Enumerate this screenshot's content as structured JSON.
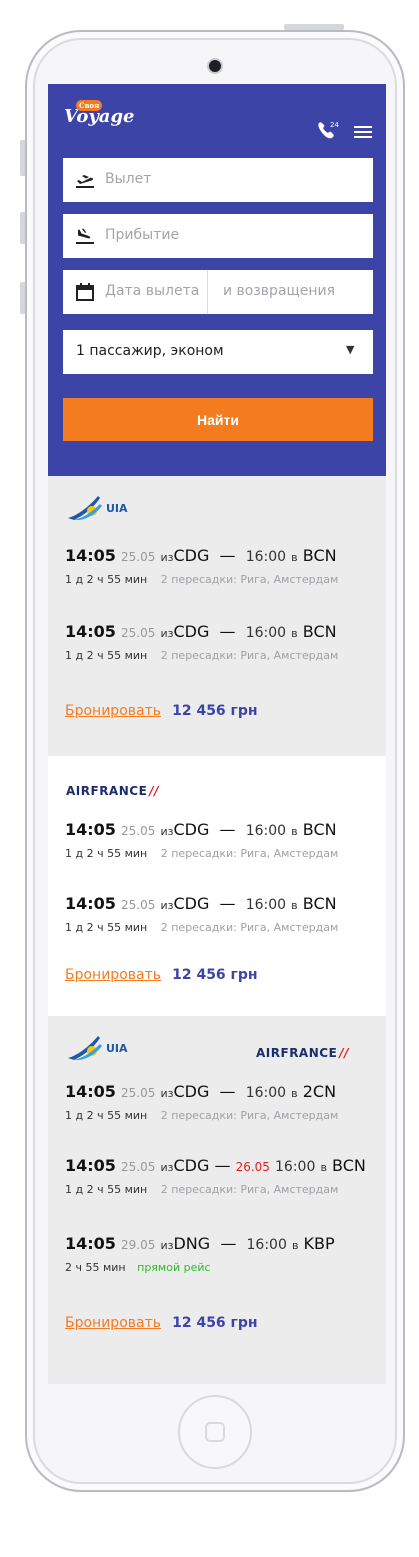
{
  "app": {
    "brand_tag": "Своя",
    "brand_name": "Voyage",
    "phone_badge": "24"
  },
  "search": {
    "departure_placeholder": "Вылет",
    "arrival_placeholder": "Прибытие",
    "date_departure_placeholder": "Дата вылета",
    "date_return_placeholder": "и возвращения",
    "passengers_value": "1 пассажир, эконом",
    "submit_label": "Найти"
  },
  "results": [
    {
      "airlines": [
        "UIA"
      ],
      "legs": [
        {
          "dep_time": "14:05",
          "dep_date": "25.05",
          "from_prefix": "из",
          "from": "CDG",
          "dash": "—",
          "arr_time": "16:00",
          "to_prefix": "в",
          "to": "BCN",
          "duration": "1 д 2 ч 55 мин",
          "stops": "2 пересадки: Рига, Амстердам"
        },
        {
          "dep_time": "14:05",
          "dep_date": "25.05",
          "from_prefix": "из",
          "from": "CDG",
          "dash": "—",
          "arr_time": "16:00",
          "to_prefix": "в",
          "to": "BCN",
          "duration": "1 д 2 ч 55 мин",
          "stops": "2 пересадки: Рига, Амстердам"
        }
      ],
      "book_label": "Бронировать",
      "price": "12 456 грн"
    },
    {
      "airlines": [
        "AIRFRANCE"
      ],
      "legs": [
        {
          "dep_time": "14:05",
          "dep_date": "25.05",
          "from_prefix": "из",
          "from": "CDG",
          "dash": "—",
          "arr_time": "16:00",
          "to_prefix": "в",
          "to": "BCN",
          "duration": "1 д 2 ч 55 мин",
          "stops": "2 пересадки: Рига, Амстердам"
        },
        {
          "dep_time": "14:05",
          "dep_date": "25.05",
          "from_prefix": "из",
          "from": "CDG",
          "dash": "—",
          "arr_time": "16:00",
          "to_prefix": "в",
          "to": "BCN",
          "duration": "1 д 2 ч 55 мин",
          "stops": "2 пересадки: Рига, Амстердам"
        }
      ],
      "book_label": "Бронировать",
      "price": "12 456 грн"
    },
    {
      "airlines": [
        "UIA",
        "AIRFRANCE"
      ],
      "legs": [
        {
          "dep_time": "14:05",
          "dep_date": "25.05",
          "from_prefix": "из",
          "from": "CDG",
          "dash": "—",
          "arr_time": "16:00",
          "to_prefix": "в",
          "to": "2CN",
          "duration": "1 д 2 ч 55 мин",
          "stops": "2 пересадки: Рига, Амстердам"
        },
        {
          "dep_time": "14:05",
          "dep_date": "25.05",
          "from_prefix": "из",
          "from": "CDG",
          "dash": "—",
          "arr_date": "26.05",
          "arr_time": "16:00",
          "to_prefix": "в",
          "to": "BCN",
          "duration": "1 д 2 ч 55 мин",
          "stops": "2 пересадки: Рига, Амстердам"
        },
        {
          "dep_time": "14:05",
          "dep_date": "29.05",
          "from_prefix": "из",
          "from": "DNG",
          "dash": "—",
          "arr_time": "16:00",
          "to_prefix": "в",
          "to": "KBP",
          "duration": "2 ч 55 мин",
          "direct": "прямой рейс"
        }
      ],
      "book_label": "Бронировать",
      "price": "12 456 грн"
    }
  ],
  "colors": {
    "header": "#3c45a7",
    "accent": "#f47c20",
    "price": "#3c45a7",
    "direct": "#2eb82e",
    "next_day": "#e02020"
  },
  "icons": [
    "logo-icon",
    "phone-24-icon",
    "menu-icon",
    "takeoff-icon",
    "landing-icon",
    "calendar-icon",
    "caret-down-icon",
    "uia-logo-icon",
    "airfrance-logo-icon"
  ]
}
